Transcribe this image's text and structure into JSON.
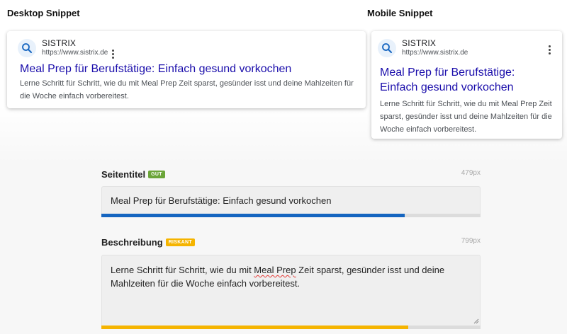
{
  "sections": {
    "desktop_title": "Desktop Snippet",
    "mobile_title": "Mobile Snippet"
  },
  "snippet": {
    "site_name": "SISTRIX",
    "url": "https://www.sistrix.de",
    "favicon_icon": "search-icon",
    "title": "Meal Prep für Berufstätige: Einfach gesund vorkochen",
    "description": "Lerne Schritt für Schritt, wie du mit Meal Prep Zeit sparst, gesünder isst und deine Mahlzeiten für die Woche einfach vorbereitest."
  },
  "fields": {
    "title": {
      "label": "Seitentitel",
      "badge": "GUT",
      "pixel_width": "479px",
      "value": "Meal Prep für Berufstätige: Einfach gesund vorkochen",
      "meter_level_percent": 80,
      "meter_color": "#1565c0",
      "badge_color": "#6ba539"
    },
    "description": {
      "label": "Beschreibung",
      "badge": "RISKANT",
      "pixel_width": "799px",
      "value_before": "Lerne Schritt für Schritt, wie du mit ",
      "value_misspelled": "Meal Prep",
      "value_after": " Zeit sparst, gesünder isst und deine Mahlzeiten für die Woche einfach vorbereitest.",
      "meter_level_percent": 81,
      "meter_color": "#f5b400",
      "badge_color": "#f5b400"
    }
  },
  "colors": {
    "serp_title": "#1a0dab",
    "serp_text": "#4d5156"
  }
}
